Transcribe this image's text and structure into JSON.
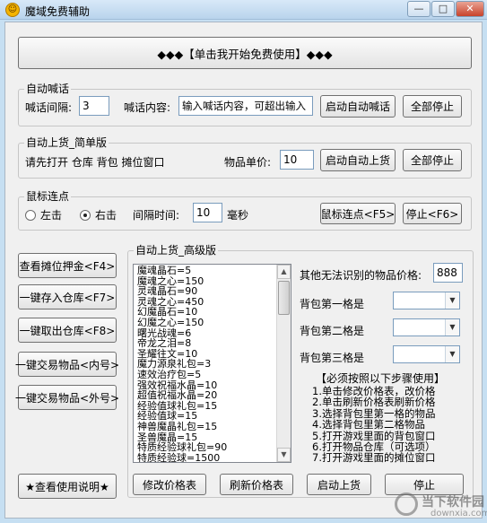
{
  "window": {
    "title": "魔域免费辅助",
    "icon": "smiley-icon",
    "controls": {
      "minimize": "—",
      "maximize": "□",
      "close": "✕"
    }
  },
  "start_button": "◆◆◆【单击我开始免费使用】◆◆◆",
  "auto_shout": {
    "title": "自动喊话",
    "interval_label": "喊话间隔:",
    "interval_value": "3",
    "content_label": "喊话内容:",
    "content_value": "输入喊话内容，可超出输入",
    "start_button": "启动自动喊话",
    "stop_button": "全部停止"
  },
  "simple_shelf": {
    "title": "自动上货_简单版",
    "hint_text": "请先打开 仓库 背包 摊位窗口",
    "price_label": "物品单价:",
    "price_value": "10",
    "start_button": "启动自动上货",
    "stop_button": "全部停止"
  },
  "mouse_click": {
    "title": "鼠标连点",
    "left_option": "左击",
    "right_option": "右击",
    "selected": "right",
    "interval_label": "间隔时间:",
    "interval_value": "10",
    "unit": "毫秒",
    "start_button": "鼠标连点<F5>",
    "stop_button": "停止<F6>"
  },
  "side_buttons": [
    "查看摊位押金<F4>",
    "一键存入仓库<F7>",
    "一键取出仓库<F8>",
    "一键交易物品<内号>",
    "一键交易物品<外号>"
  ],
  "help_button": "★查看使用说明★",
  "advanced_shelf": {
    "title": "自动上货_高级版",
    "price_list": [
      "魔魂晶石=5",
      "魔魂之心=150",
      "灵魂晶石=90",
      "灵魂之心=450",
      "幻魔晶石=10",
      "幻魔之心=150",
      "曙光战魂=6",
      "帝龙之泪=8",
      "圣耀往文=10",
      "魔力源泉礼包=3",
      "速效治疗包=5",
      "强效祝福水晶=10",
      "超值祝福水晶=20",
      "经验值球礼包=15",
      "经验值球=15",
      "神兽魔晶礼包=15",
      "圣兽魔晶=15",
      "特质经验球礼包=90",
      "特质经验球=1500"
    ],
    "unknown_price_label": "其他无法识别的物品价格:",
    "unknown_price_value": "888",
    "slot1_label": "背包第一格是",
    "slot2_label": "背包第二格是",
    "slot3_label": "背包第三格是",
    "instructions_title": "【必须按照以下步骤使用】",
    "instructions": [
      "1.单击修改价格表，改价格",
      "2.单击刷新价格表刷新价格",
      "3.选择背包里第一格的物品",
      "4.选择背包里第二格物品",
      "5.打开游戏里面的背包窗口",
      "6.打开物品仓库（可选项）",
      "7.打开游戏里面的摊位窗口"
    ],
    "edit_button": "修改价格表",
    "refresh_button": "刷新价格表",
    "start_button": "启动上货",
    "stop_button": "停止"
  },
  "watermark": {
    "text": "当下软件园",
    "subtext": "downxia.com"
  }
}
